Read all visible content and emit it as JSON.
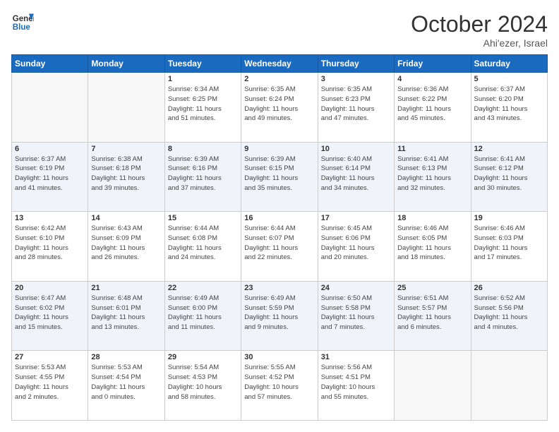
{
  "logo": {
    "line1": "General",
    "line2": "Blue"
  },
  "title": "October 2024",
  "location": "Ahi'ezer, Israel",
  "days_header": [
    "Sunday",
    "Monday",
    "Tuesday",
    "Wednesday",
    "Thursday",
    "Friday",
    "Saturday"
  ],
  "weeks": [
    [
      {
        "day": "",
        "info": ""
      },
      {
        "day": "",
        "info": ""
      },
      {
        "day": "1",
        "info": "Sunrise: 6:34 AM\nSunset: 6:25 PM\nDaylight: 11 hours\nand 51 minutes."
      },
      {
        "day": "2",
        "info": "Sunrise: 6:35 AM\nSunset: 6:24 PM\nDaylight: 11 hours\nand 49 minutes."
      },
      {
        "day": "3",
        "info": "Sunrise: 6:35 AM\nSunset: 6:23 PM\nDaylight: 11 hours\nand 47 minutes."
      },
      {
        "day": "4",
        "info": "Sunrise: 6:36 AM\nSunset: 6:22 PM\nDaylight: 11 hours\nand 45 minutes."
      },
      {
        "day": "5",
        "info": "Sunrise: 6:37 AM\nSunset: 6:20 PM\nDaylight: 11 hours\nand 43 minutes."
      }
    ],
    [
      {
        "day": "6",
        "info": "Sunrise: 6:37 AM\nSunset: 6:19 PM\nDaylight: 11 hours\nand 41 minutes."
      },
      {
        "day": "7",
        "info": "Sunrise: 6:38 AM\nSunset: 6:18 PM\nDaylight: 11 hours\nand 39 minutes."
      },
      {
        "day": "8",
        "info": "Sunrise: 6:39 AM\nSunset: 6:16 PM\nDaylight: 11 hours\nand 37 minutes."
      },
      {
        "day": "9",
        "info": "Sunrise: 6:39 AM\nSunset: 6:15 PM\nDaylight: 11 hours\nand 35 minutes."
      },
      {
        "day": "10",
        "info": "Sunrise: 6:40 AM\nSunset: 6:14 PM\nDaylight: 11 hours\nand 34 minutes."
      },
      {
        "day": "11",
        "info": "Sunrise: 6:41 AM\nSunset: 6:13 PM\nDaylight: 11 hours\nand 32 minutes."
      },
      {
        "day": "12",
        "info": "Sunrise: 6:41 AM\nSunset: 6:12 PM\nDaylight: 11 hours\nand 30 minutes."
      }
    ],
    [
      {
        "day": "13",
        "info": "Sunrise: 6:42 AM\nSunset: 6:10 PM\nDaylight: 11 hours\nand 28 minutes."
      },
      {
        "day": "14",
        "info": "Sunrise: 6:43 AM\nSunset: 6:09 PM\nDaylight: 11 hours\nand 26 minutes."
      },
      {
        "day": "15",
        "info": "Sunrise: 6:44 AM\nSunset: 6:08 PM\nDaylight: 11 hours\nand 24 minutes."
      },
      {
        "day": "16",
        "info": "Sunrise: 6:44 AM\nSunset: 6:07 PM\nDaylight: 11 hours\nand 22 minutes."
      },
      {
        "day": "17",
        "info": "Sunrise: 6:45 AM\nSunset: 6:06 PM\nDaylight: 11 hours\nand 20 minutes."
      },
      {
        "day": "18",
        "info": "Sunrise: 6:46 AM\nSunset: 6:05 PM\nDaylight: 11 hours\nand 18 minutes."
      },
      {
        "day": "19",
        "info": "Sunrise: 6:46 AM\nSunset: 6:03 PM\nDaylight: 11 hours\nand 17 minutes."
      }
    ],
    [
      {
        "day": "20",
        "info": "Sunrise: 6:47 AM\nSunset: 6:02 PM\nDaylight: 11 hours\nand 15 minutes."
      },
      {
        "day": "21",
        "info": "Sunrise: 6:48 AM\nSunset: 6:01 PM\nDaylight: 11 hours\nand 13 minutes."
      },
      {
        "day": "22",
        "info": "Sunrise: 6:49 AM\nSunset: 6:00 PM\nDaylight: 11 hours\nand 11 minutes."
      },
      {
        "day": "23",
        "info": "Sunrise: 6:49 AM\nSunset: 5:59 PM\nDaylight: 11 hours\nand 9 minutes."
      },
      {
        "day": "24",
        "info": "Sunrise: 6:50 AM\nSunset: 5:58 PM\nDaylight: 11 hours\nand 7 minutes."
      },
      {
        "day": "25",
        "info": "Sunrise: 6:51 AM\nSunset: 5:57 PM\nDaylight: 11 hours\nand 6 minutes."
      },
      {
        "day": "26",
        "info": "Sunrise: 6:52 AM\nSunset: 5:56 PM\nDaylight: 11 hours\nand 4 minutes."
      }
    ],
    [
      {
        "day": "27",
        "info": "Sunrise: 5:53 AM\nSunset: 4:55 PM\nDaylight: 11 hours\nand 2 minutes."
      },
      {
        "day": "28",
        "info": "Sunrise: 5:53 AM\nSunset: 4:54 PM\nDaylight: 11 hours\nand 0 minutes."
      },
      {
        "day": "29",
        "info": "Sunrise: 5:54 AM\nSunset: 4:53 PM\nDaylight: 10 hours\nand 58 minutes."
      },
      {
        "day": "30",
        "info": "Sunrise: 5:55 AM\nSunset: 4:52 PM\nDaylight: 10 hours\nand 57 minutes."
      },
      {
        "day": "31",
        "info": "Sunrise: 5:56 AM\nSunset: 4:51 PM\nDaylight: 10 hours\nand 55 minutes."
      },
      {
        "day": "",
        "info": ""
      },
      {
        "day": "",
        "info": ""
      }
    ]
  ]
}
